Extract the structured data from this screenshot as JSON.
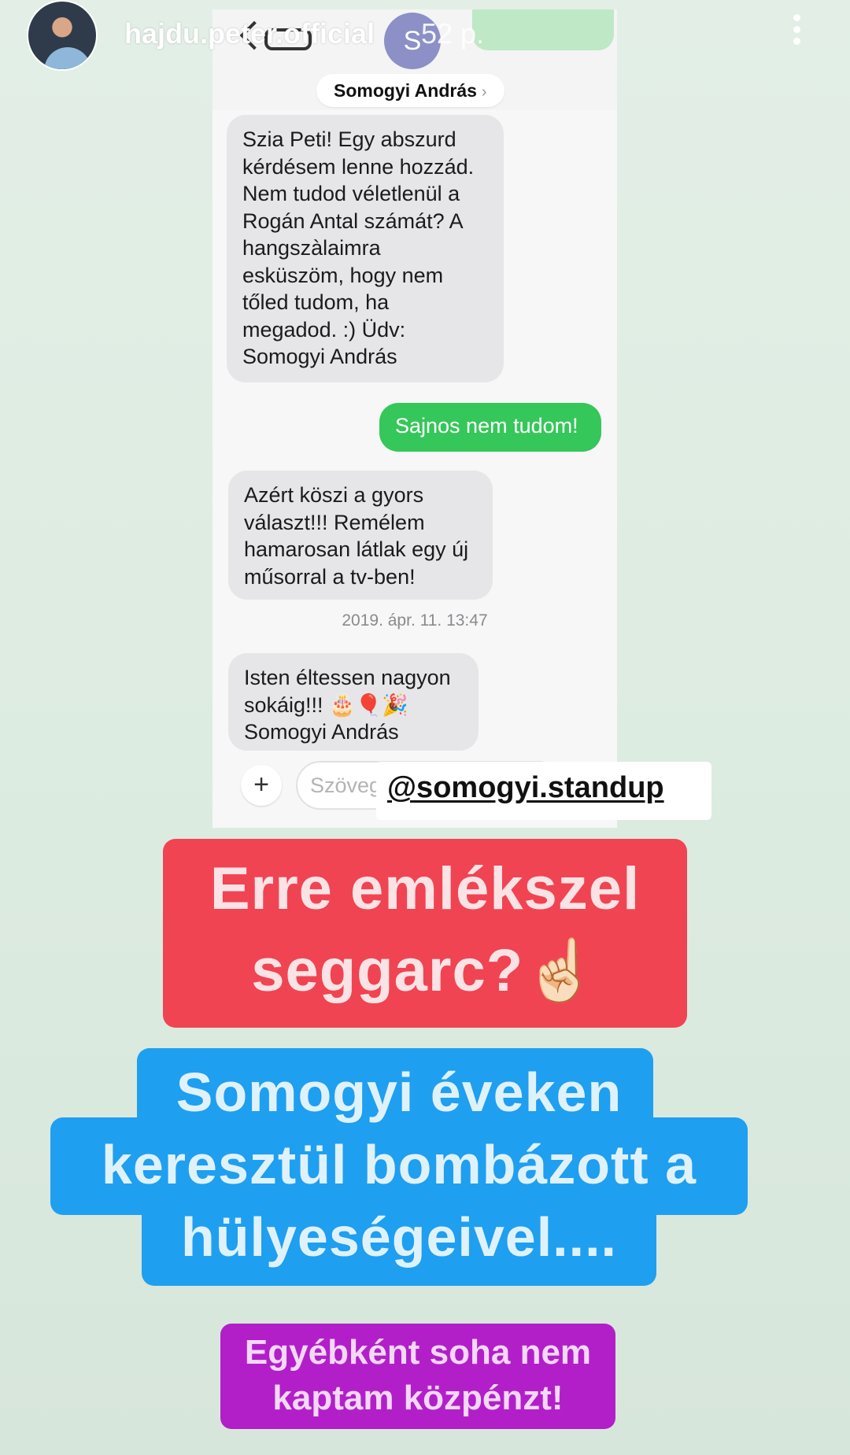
{
  "story": {
    "username": "hajdu.peter.official",
    "time_ago": "52 p.",
    "more_icon": "more-vertical-icon"
  },
  "screenshot": {
    "contact_initial": "S",
    "contact_name": "Somogyi András",
    "messages": [
      {
        "direction": "in",
        "text": "Szia Peti! Egy abszurd kérdésem lenne hozzád. Nem tudod véletlenül a Rogán Antal számát? A hangszàlaimra esküszöm, hogy nem tőled tudom, ha megadod. :) Üdv: Somogyi András"
      },
      {
        "direction": "out",
        "text": "Sajnos nem tudom!"
      },
      {
        "direction": "in",
        "text": "Azért köszi a gyors választ!!! Remélem hamarosan látlak egy új műsorral a tv-ben!"
      },
      {
        "direction": "in",
        "text": "Isten éltessen nagyon sokáig!!! 🎂🎈🎉 Somogyi András"
      }
    ],
    "timestamp": "2019. ápr. 11. 13:47",
    "compose_placeholder": "Szöveg"
  },
  "mention": "@somogyi.standup",
  "captions": {
    "red": "Erre emlékszel seggarc?☝🏻",
    "blue": "Somogyi éveken keresztül bombázott a hülyeségeivel....",
    "purple": "Egyébként soha nem kaptam közpénzt!"
  },
  "colors": {
    "caption_red": "#f04453",
    "caption_blue": "#1f9ff0",
    "caption_purple": "#b21fc9",
    "imessage_green": "#35c759"
  }
}
